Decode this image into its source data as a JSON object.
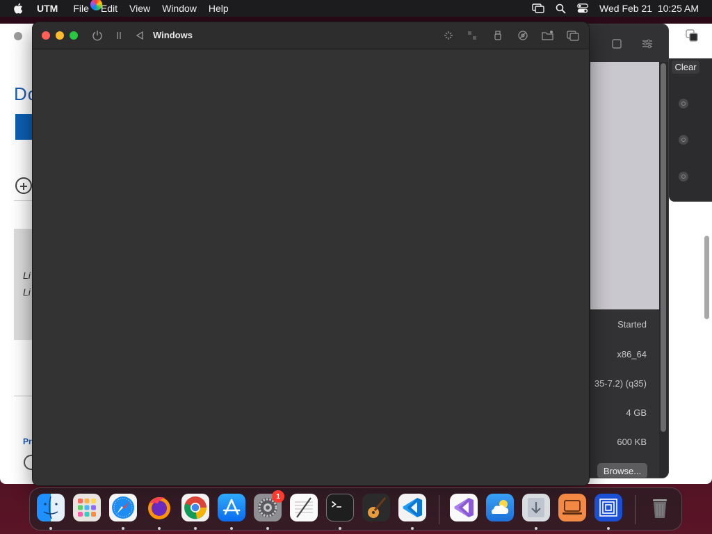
{
  "menubar": {
    "app_name": "UTM",
    "items": [
      "File",
      "Edit",
      "View",
      "Window",
      "Help"
    ],
    "datetime": "Wed Feb 21  10:25 AM",
    "icons": [
      "apple-icon",
      "screen-mirroring-icon",
      "spotlight-search-icon",
      "control-center-icon"
    ]
  },
  "background_browser": {
    "page_title": "Do",
    "italic_lines": [
      "Li",
      "Li"
    ],
    "section_label": "Pr"
  },
  "utm_main": {
    "clear_label": "Clear",
    "info": {
      "status": "Started",
      "architecture": "x86_64",
      "machine": "35-7.2) (q35)",
      "memory": "4 GB",
      "size": "600 KB"
    },
    "browse_label": "Browse..."
  },
  "vm_window": {
    "title": "Windows",
    "left_icons": [
      "power-icon",
      "pause-icon",
      "restart-icon"
    ],
    "right_icons": [
      "capture-input-icon",
      "resize-icon",
      "usb-icon",
      "drive-icon",
      "shared-folder-icon",
      "windows-icon"
    ]
  },
  "dock": {
    "apps": [
      "Finder",
      "Launchpad",
      "Safari",
      "Firefox",
      "Chrome",
      "App Store",
      "System Settings",
      "TextEdit",
      "Terminal",
      "GarageBand",
      "Visual Studio Code",
      "Visual Studio",
      "iCloud",
      "Downloads",
      "Screen Sharing",
      "UTM"
    ],
    "settings_badge": "1",
    "trash": "Trash"
  }
}
